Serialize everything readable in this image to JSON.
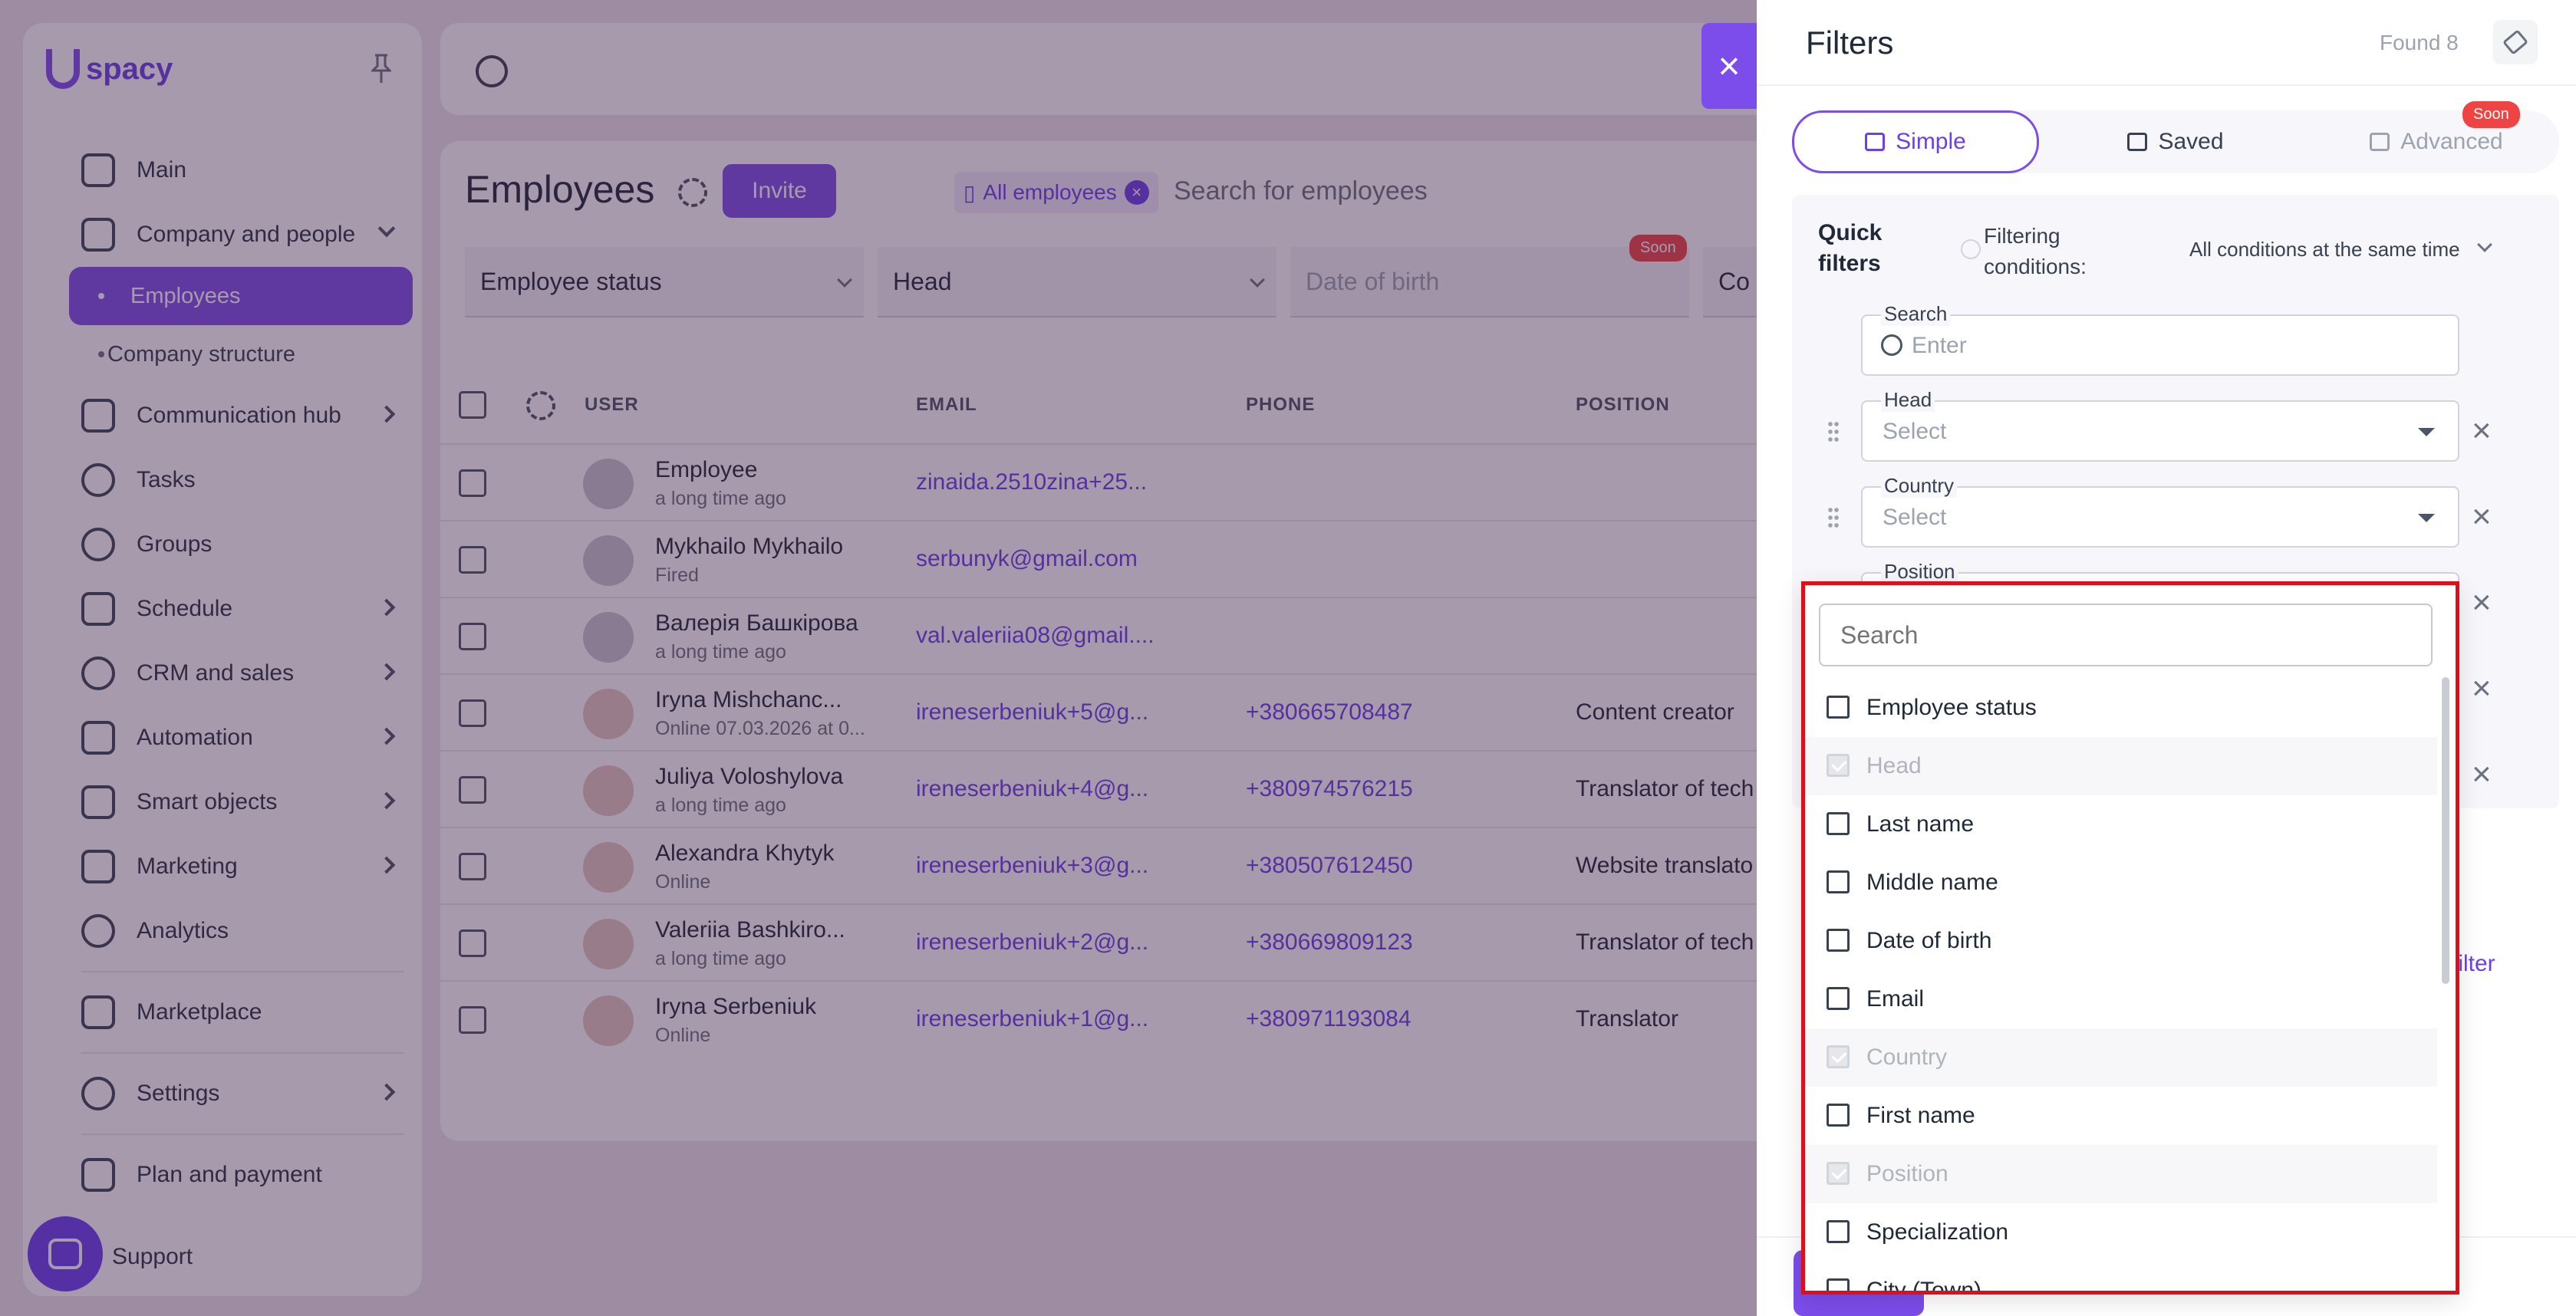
{
  "app": {
    "logo_text": "spacy"
  },
  "sidebar": {
    "items": [
      {
        "label": "Main"
      },
      {
        "label": "Company and people"
      },
      {
        "label": "Employees"
      },
      {
        "label": "Company structure"
      },
      {
        "label": "Communication hub"
      },
      {
        "label": "Tasks"
      },
      {
        "label": "Groups"
      },
      {
        "label": "Schedule"
      },
      {
        "label": "CRM and sales"
      },
      {
        "label": "Automation"
      },
      {
        "label": "Smart objects"
      },
      {
        "label": "Marketing"
      },
      {
        "label": "Analytics"
      },
      {
        "label": "Marketplace"
      },
      {
        "label": "Settings"
      },
      {
        "label": "Plan and payment"
      },
      {
        "label": "Support"
      }
    ]
  },
  "employees": {
    "title": "Employees",
    "invite_label": "Invite",
    "chip_label": "All employees",
    "search_placeholder": "Search for employees",
    "filters": [
      "Employee status",
      "Head",
      "Date of birth",
      "Co"
    ],
    "soon_label": "Soon",
    "columns": [
      "USER",
      "EMAIL",
      "PHONE",
      "POSITION"
    ],
    "rows": [
      {
        "name": "Employee",
        "sub": "a long time ago",
        "email": "zinaida.2510zina+25...",
        "phone": "",
        "position": ""
      },
      {
        "name": "Mykhailo Mykhailo",
        "sub": "Fired",
        "email": "serbunyk@gmail.com",
        "phone": "",
        "position": ""
      },
      {
        "name": "Валерія Башкірова",
        "sub": "a long time ago",
        "email": "val.valeriia08@gmail....",
        "phone": "",
        "position": ""
      },
      {
        "name": "Iryna Mishchanc...",
        "sub": "Online 07.03.2026 at 0...",
        "email": "ireneserbeniuk+5@g...",
        "phone": "+380665708487",
        "position": "Content creator"
      },
      {
        "name": "Juliya Voloshylova",
        "sub": "a long time ago",
        "email": "ireneserbeniuk+4@g...",
        "phone": "+380974576215",
        "position": "Translator of tech"
      },
      {
        "name": "Alexandra Khytyk",
        "sub": "Online",
        "email": "ireneserbeniuk+3@g...",
        "phone": "+380507612450",
        "position": "Website translato"
      },
      {
        "name": "Valeriia Bashkiro...",
        "sub": "a long time ago",
        "email": "ireneserbeniuk+2@g...",
        "phone": "+380669809123",
        "position": "Translator of tech"
      },
      {
        "name": "Iryna Serbeniuk",
        "sub": "Online",
        "email": "ireneserbeniuk+1@g...",
        "phone": "+380971193084",
        "position": "Translator"
      }
    ]
  },
  "filters_panel": {
    "title": "Filters",
    "found": "Found 8",
    "tabs": [
      {
        "label": "Simple"
      },
      {
        "label": "Saved"
      },
      {
        "label": "Advanced"
      }
    ],
    "soon_label": "Soon",
    "quick_filters_label": "Quick filters",
    "conditions_label": "Filtering conditions:",
    "conditions_value": "All conditions at the same time",
    "search_field": {
      "label": "Search",
      "placeholder": "Enter"
    },
    "head_field": {
      "label": "Head",
      "placeholder": "Select"
    },
    "country_field": {
      "label": "Country",
      "placeholder": "Select"
    },
    "position_field": {
      "label": "Position"
    },
    "add_filter_label": "filter"
  },
  "dropdown": {
    "search_placeholder": "Search",
    "options": [
      {
        "label": "Employee status",
        "disabled": false
      },
      {
        "label": "Head",
        "disabled": true
      },
      {
        "label": "Last name",
        "disabled": false
      },
      {
        "label": "Middle name",
        "disabled": false
      },
      {
        "label": "Date of birth",
        "disabled": false
      },
      {
        "label": "Email",
        "disabled": false
      },
      {
        "label": "Country",
        "disabled": true
      },
      {
        "label": "First name",
        "disabled": false
      },
      {
        "label": "Position",
        "disabled": true
      },
      {
        "label": "Specialization",
        "disabled": false
      },
      {
        "label": "City (Town)",
        "disabled": false
      }
    ]
  }
}
